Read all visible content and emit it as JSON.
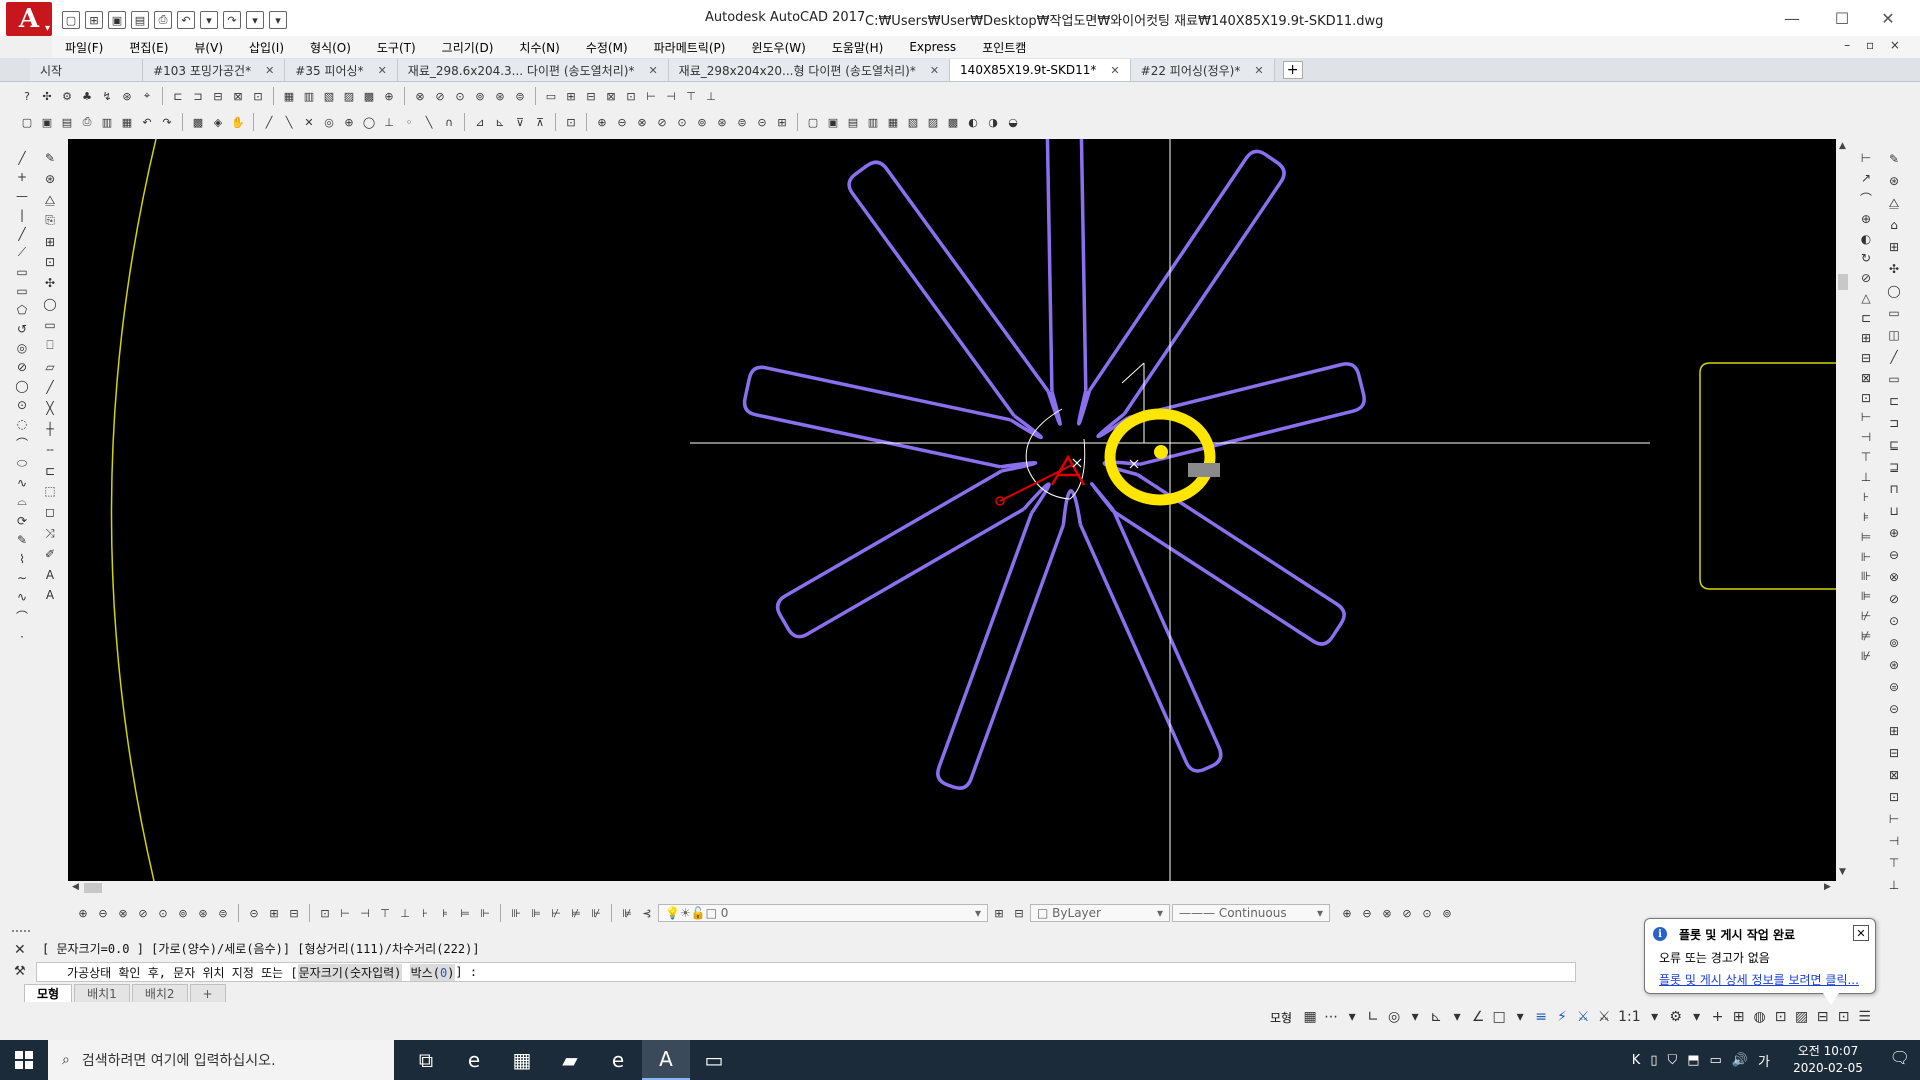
{
  "window": {
    "app_logo": "A",
    "title": "Autodesk AutoCAD 2017",
    "path": "C:₩Users₩User₩Desktop₩작업도면₩와이어컷팅 재료₩140X85X19.9t-SKD11.dwg",
    "minimize": "—",
    "maximize": "☐",
    "close": "✕"
  },
  "quick_access": [
    "▢",
    "⊞",
    "▣",
    "▤",
    "⎙",
    "↶",
    "▾",
    "↷",
    "▾",
    "▾"
  ],
  "menu": [
    "파일(F)",
    "편집(E)",
    "뷰(V)",
    "삽입(I)",
    "형식(O)",
    "도구(T)",
    "그리기(D)",
    "치수(N)",
    "수정(M)",
    "파라메트릭(P)",
    "윈도우(W)",
    "도움말(H)",
    "Express",
    "포인트캠"
  ],
  "menu_right": "– ▫ ×",
  "file_tabs": [
    {
      "label": "시작",
      "close": ""
    },
    {
      "label": "#103 포밍가공건*",
      "close": "✕"
    },
    {
      "label": "#35 피어싱*",
      "close": "✕"
    },
    {
      "label": "재료_298.6x204.3... 다이편 (송도열처리)*",
      "close": "✕"
    },
    {
      "label": "재료_298x204x20...형 다이편 (송도열처리)*",
      "close": "✕"
    },
    {
      "label": "140X85X19.9t-SKD11*",
      "close": "✕"
    },
    {
      "label": "#22 피어싱(정우)*",
      "close": "✕"
    }
  ],
  "tab_plus": "+",
  "toolbar1": [
    "?",
    "✣",
    "⚙",
    "♣",
    "↯",
    "⊛",
    "⌖",
    "|",
    "⊏",
    "⊐",
    "⊟",
    "⊠",
    "⊡",
    "|",
    "▦",
    "▥",
    "▧",
    "▨",
    "▩",
    "⊕",
    "|",
    "⊗",
    "⊘",
    "⊙",
    "⊚",
    "⊛",
    "⊜",
    "|",
    "▭",
    "⊞",
    "⊟",
    "⊠",
    "⊡",
    "⊢",
    "⊣",
    "⊤",
    "⊥"
  ],
  "toolbar2": [
    "▢",
    "▣",
    "▤",
    "⎙",
    "▥",
    "▦",
    "↶",
    "↷",
    "|",
    "▩",
    "◈",
    "✋",
    "|",
    "╱",
    "╲",
    "✕",
    "◎",
    "⊕",
    "◯",
    "⊥",
    "◦",
    "╲",
    "∩",
    "|",
    "⊿",
    "⊾",
    "⊽",
    "⊼",
    "|",
    "⊡",
    "|",
    "⊕",
    "⊖",
    "⊗",
    "⊘",
    "⊙",
    "⊚",
    "⊛",
    "⊜",
    "⊝",
    "⊞",
    "|",
    "▢",
    "▣",
    "▤",
    "▥",
    "▦",
    "▧",
    "▨",
    "▩",
    "◐",
    "◑",
    "◒"
  ],
  "left_palette_a": [
    "╱",
    "+",
    "—",
    "|",
    "╱",
    "⟋",
    "▭",
    "▭",
    "⬠",
    "↺",
    "◎",
    "⊘",
    "◯",
    "⊙",
    "◌",
    "⌒",
    "⬭",
    "∿",
    "⌓",
    "⟳",
    "✎",
    "⌇",
    "∼",
    "∿",
    "⌒",
    "⋅"
  ],
  "left_palette_b": [
    "✎",
    "⊛",
    "⧋",
    "⎘",
    "⊞",
    "⊡",
    "✣",
    "◯",
    "▭",
    "⎕",
    "▱",
    "╱",
    "╳",
    "┼",
    "╌",
    "⊏",
    "⬚",
    "◻",
    "⤨",
    "✐",
    "A",
    "A"
  ],
  "right_palette_a": [
    "⊢",
    "↗",
    "⌒",
    "⊕",
    "◐",
    "↻",
    "⊘",
    "△",
    "⊏",
    "⊞",
    "⊟",
    "⊠",
    "⊡",
    "⊢",
    "⊣",
    "⊤",
    "⊥",
    "⊦",
    "⊧",
    "⊨",
    "⊩",
    "⊪",
    "⊫",
    "⊬",
    "⊭",
    "⊮"
  ],
  "right_palette_b": [
    "✎",
    "⊛",
    "⧋",
    "⌂",
    "⊞",
    "✣",
    "◯",
    "▭",
    "◫",
    "╱",
    "▭",
    "⊏",
    "⊐",
    "⊑",
    "⊒",
    "⊓",
    "⊔",
    "⊕",
    "⊖",
    "⊗",
    "⊘",
    "⊙",
    "⊚",
    "⊛",
    "⊜",
    "⊝",
    "⊞",
    "⊟",
    "⊠",
    "⊡",
    "⊢",
    "⊣",
    "⊤",
    "⊥"
  ],
  "props": {
    "icons1": [
      "⊕",
      "⊖",
      "⊗",
      "⊘",
      "⊙",
      "⊚",
      "⊛",
      "⊜",
      "|",
      "⊝",
      "⊞",
      "⊟",
      "|",
      "⊡"
    ],
    "icons2": [
      "⊢",
      "⊣",
      "⊤",
      "⊥",
      "⊦",
      "⊧",
      "⊨",
      "⊩",
      "|",
      "⊪",
      "⊫",
      "⊬",
      "⊭",
      "⊮",
      "|",
      "⊯",
      "⊰"
    ],
    "layer_value": "0",
    "color_value": "ByLayer",
    "linetype_value": "Continuous",
    "icons3": [
      "⊕",
      "⊖",
      "⊗",
      "⊘",
      "⊙",
      "⊚"
    ]
  },
  "command": {
    "history": "[ 문자크기=0.0 ] [가로(양수)/세로(음수)] [형상거리(111)/차수거리(222)]",
    "prompt_prefix": "가공상태 확인 후, 문자 위치 지정 또는 [",
    "opt1": "문자크기(숫자입력)",
    "opt2_text": "박스(",
    "opt2_key": "0",
    "opt2_end": ")",
    "prompt_suffix": "] :",
    "close": "✕",
    "wrench": "🔧"
  },
  "layout_tabs": [
    "모형",
    "배치1",
    "배치2"
  ],
  "layout_plus": "+",
  "status": {
    "model": "모형",
    "icons": [
      "▦",
      "⋯",
      "▾",
      "∟",
      "◎",
      "▾",
      "⊾",
      "▾",
      "∠",
      "□",
      "▾",
      "≡",
      "⚡",
      "⚔",
      "⚔",
      "1:1",
      "▾",
      "⚙",
      "▾",
      "+",
      "⊞",
      "◍",
      "⊡",
      "▨",
      "⊟",
      "⊡",
      "☰"
    ]
  },
  "balloon": {
    "info": "i",
    "title": "플롯 및 게시 작업 완료",
    "message": "오류 또는 경고가 없음",
    "link": "플롯 및 게시 상세 정보를 보려면 클릭...",
    "close": "✕"
  },
  "taskbar": {
    "search_placeholder": "검색하려면 여기에 입력하십시오.",
    "search_icon": "⌕",
    "apps": [
      "⧉",
      "e",
      "▦",
      "▰",
      "e",
      "A",
      "▭"
    ],
    "tray": [
      "K",
      "▯",
      "⛉",
      "⬒",
      "▭",
      "🔊",
      "가"
    ],
    "time": "오전 10:07",
    "date": "2020-02-05",
    "notif": "🗨"
  },
  "colors": {
    "accent_red": "#c8161d",
    "drawing_bg": "#000000",
    "profile_purple": "#8a70ee",
    "highlight_yellow": "#ffe600",
    "border_yellow": "#d4d400",
    "crosshair": "#ffffff",
    "marker_red": "#e00000"
  }
}
